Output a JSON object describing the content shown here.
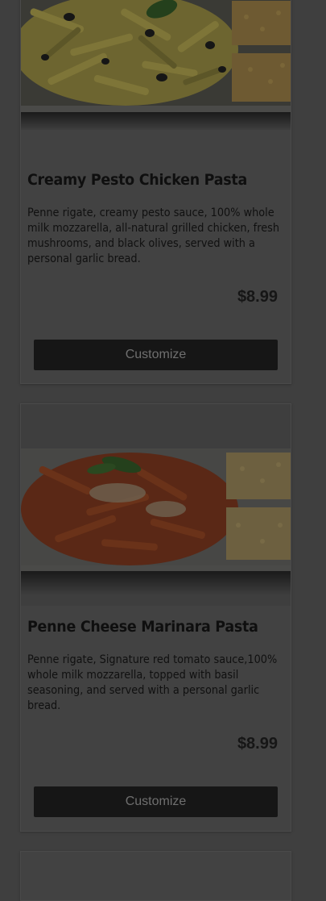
{
  "items": [
    {
      "title": "Creamy Pesto Chicken Pasta",
      "description": "Penne rigate, creamy pesto sauce, 100% whole milk mozzarella, all-natural grilled chicken, fresh mushrooms, and black olives, served with a personal garlic bread.",
      "price": "$8.99",
      "button_label": "Customize"
    },
    {
      "title": "Penne Cheese Marinara Pasta",
      "description": "Penne rigate, Signature red tomato sauce,100% whole milk mozzarella, topped with basil seasoning, and served with a personal garlic bread.",
      "price": "$8.99",
      "button_label": "Customize"
    }
  ],
  "colors": {
    "overlay_background": "#3f3f3f",
    "button_background": "#161616"
  }
}
